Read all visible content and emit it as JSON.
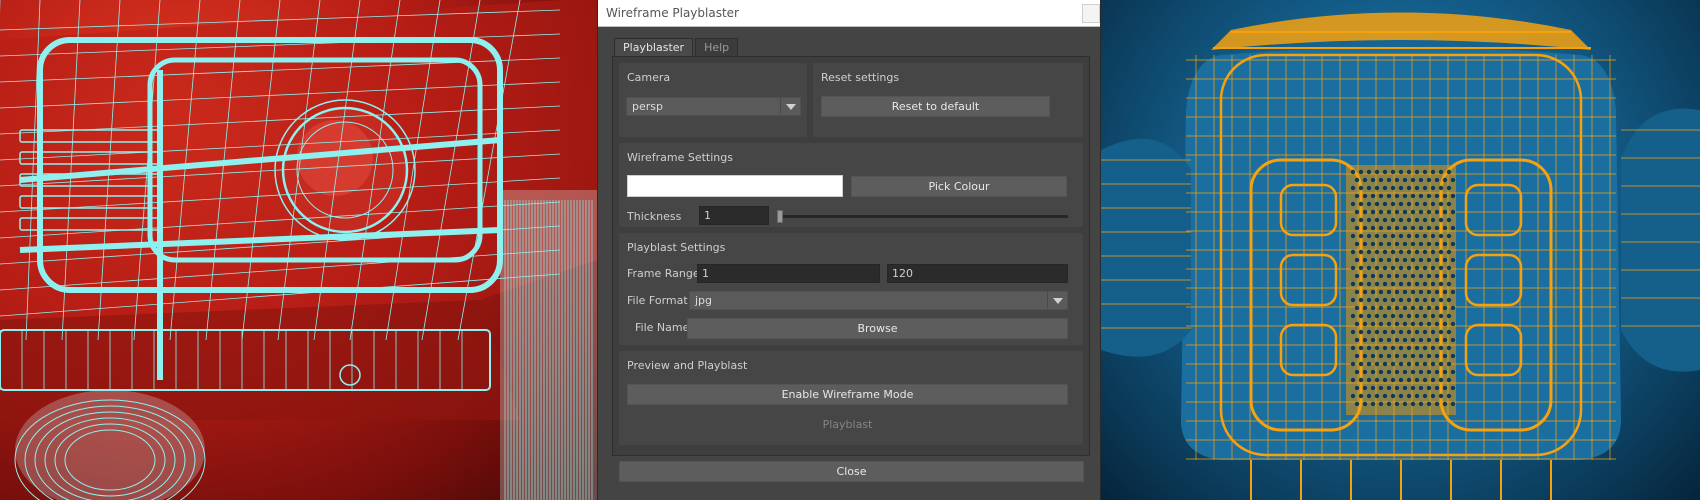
{
  "window": {
    "title": "Wireframe Playblaster"
  },
  "tabs": [
    {
      "label": "Playblaster",
      "active": true
    },
    {
      "label": "Help",
      "active": false
    }
  ],
  "camera": {
    "title": "Camera",
    "selected": "persp"
  },
  "reset": {
    "title": "Reset settings",
    "button_label": "Reset to default"
  },
  "wireframe": {
    "title": "Wireframe Settings",
    "colour_value": "#ffffff",
    "pick_label": "Pick Colour",
    "thickness_label": "Thickness",
    "thickness_value": "1",
    "thickness_slider_fraction": 0.0
  },
  "playblast": {
    "title": "Playblast Settings",
    "frame_range_label": "Frame Range",
    "frame_start": "1",
    "frame_end": "120",
    "file_format_label": "File Format",
    "file_format": "jpg",
    "file_name_label": "File Name",
    "browse_label": "Browse"
  },
  "preview": {
    "title": "Preview and Playblast",
    "wireframe_mode_label": "Enable Wireframe Mode",
    "playblast_label": "Playblast",
    "playblast_enabled": false
  },
  "footer": {
    "close_label": "Close"
  },
  "colors": {
    "left_wire": "#8ff1ef",
    "left_body": "#c0241a",
    "right_wire": "#f6a20f",
    "right_body": "#1e7fb6",
    "dialog_bg": "#444444"
  },
  "renders": {
    "left": {
      "subject": "red vehicle front with cyan wireframe"
    },
    "right": {
      "subject": "blue vehicle front with orange wireframe"
    }
  }
}
